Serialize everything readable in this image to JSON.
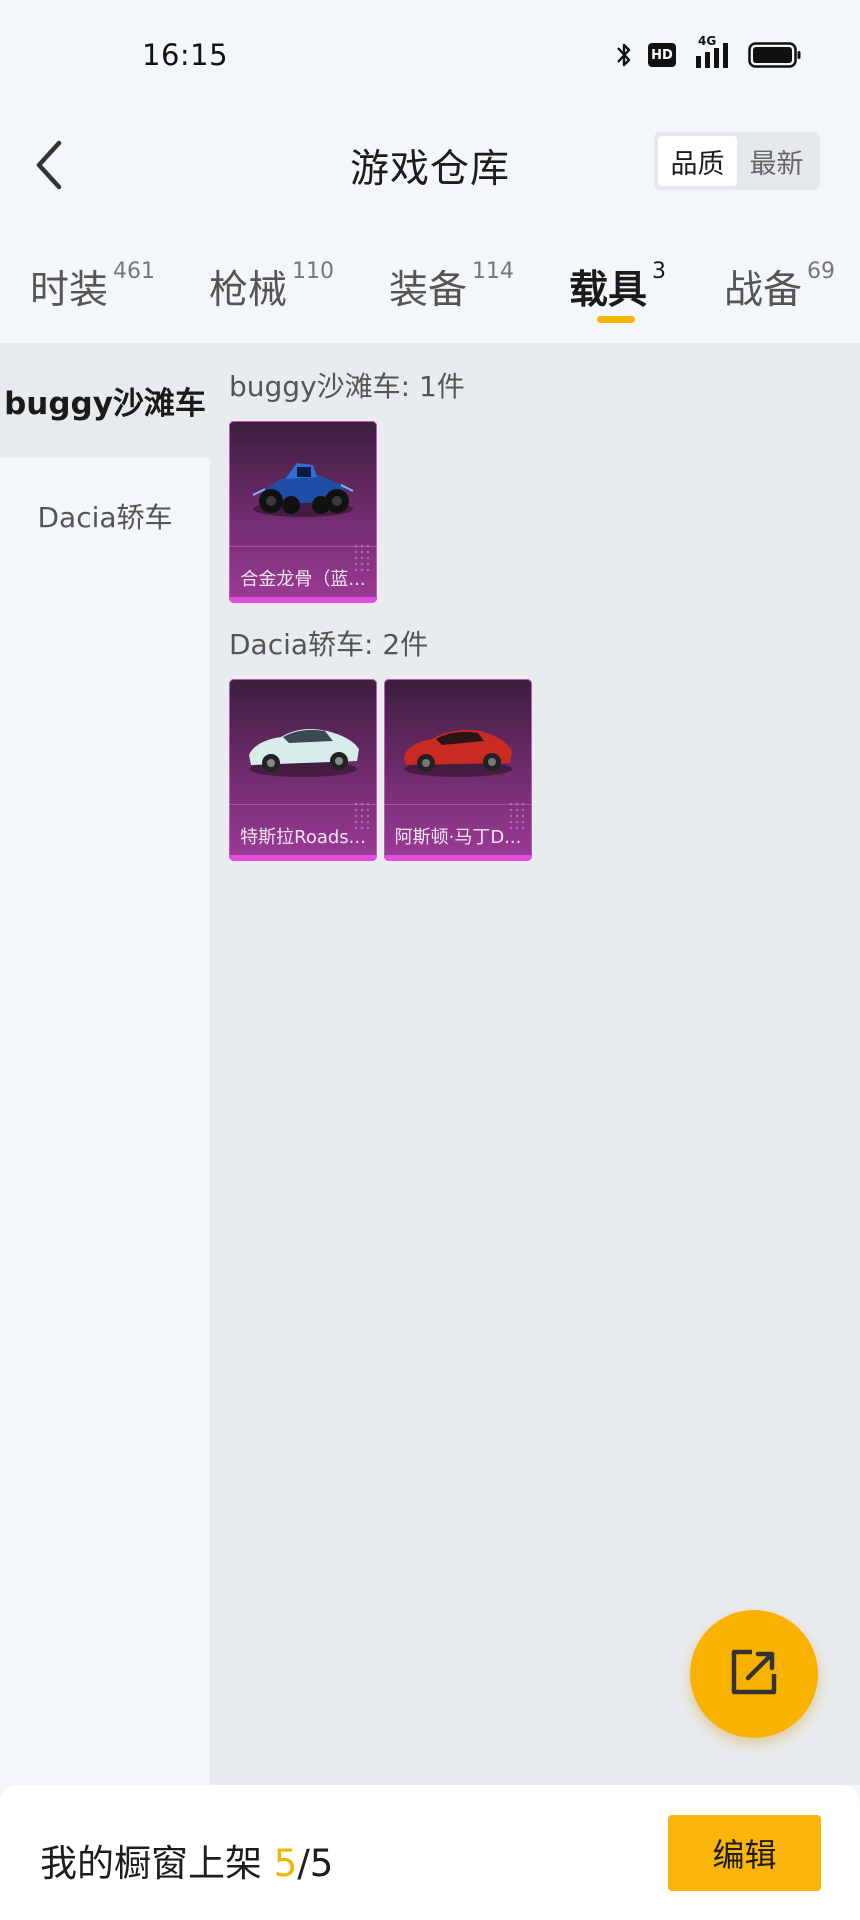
{
  "status_bar": {
    "time": "16:15",
    "icons": [
      "bluetooth-icon",
      "hd-icon",
      "signal-4g-icon",
      "battery-icon"
    ],
    "hd_label": "HD",
    "network_label": "4G"
  },
  "header": {
    "title": "游戏仓库",
    "sort_options": [
      {
        "label": "品质",
        "active": true
      },
      {
        "label": "最新",
        "active": false
      }
    ]
  },
  "tabs": [
    {
      "label": "时装",
      "count": "461",
      "active": false
    },
    {
      "label": "枪械",
      "count": "110",
      "active": false
    },
    {
      "label": "装备",
      "count": "114",
      "active": false
    },
    {
      "label": "载具",
      "count": "3",
      "active": true
    },
    {
      "label": "战备",
      "count": "69",
      "active": false
    }
  ],
  "sidebar": {
    "items": [
      {
        "label": "buggy沙滩车",
        "active": true
      },
      {
        "label": "Dacia轿车",
        "active": false
      }
    ]
  },
  "groups": [
    {
      "title": "buggy沙滩车: 1件",
      "items": [
        {
          "name": "合金龙骨（蓝...",
          "icon": "buggy-vehicle-icon"
        }
      ]
    },
    {
      "title": "Dacia轿车: 2件",
      "items": [
        {
          "name": "特斯拉Roads...",
          "icon": "white-sports-car-icon"
        },
        {
          "name": "阿斯顿·马丁D...",
          "icon": "red-sports-car-icon"
        }
      ]
    }
  ],
  "accent_color": "#f5b400",
  "card_color": "#9c3b97",
  "bottom_bar": {
    "showcase_label": "我的橱窗上架 ",
    "showcase_current": "5",
    "showcase_total": "/5",
    "edit_label": "编辑"
  },
  "fab": {
    "icon": "share-icon"
  }
}
